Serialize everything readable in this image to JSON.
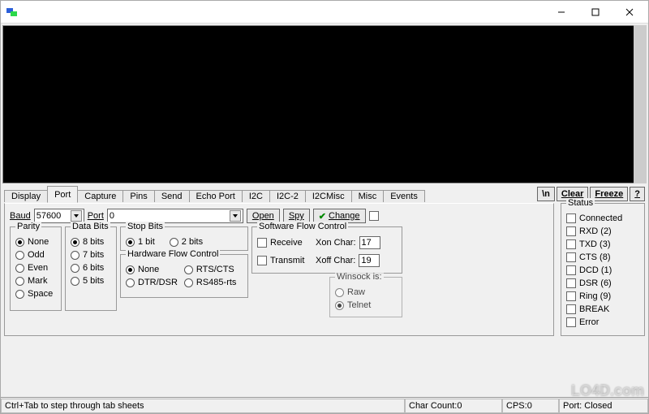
{
  "titlebar": {
    "title": ""
  },
  "window_buttons": {
    "min": "–",
    "max": "☐",
    "close": "✕"
  },
  "tabs": [
    {
      "label": "Display"
    },
    {
      "label": "Port"
    },
    {
      "label": "Capture"
    },
    {
      "label": "Pins"
    },
    {
      "label": "Send"
    },
    {
      "label": "Echo Port"
    },
    {
      "label": "I2C"
    },
    {
      "label": "I2C-2"
    },
    {
      "label": "I2CMisc"
    },
    {
      "label": "Misc"
    },
    {
      "label": "Events"
    }
  ],
  "active_tab": "Port",
  "toolbar": {
    "newline": "\\n",
    "clear": "Clear",
    "freeze": "Freeze",
    "help": "?"
  },
  "port": {
    "baud_label": "Baud",
    "baud_value": "57600",
    "port_label": "Port",
    "port_value": "0",
    "open": "Open",
    "spy": "Spy",
    "change": "Change",
    "change_checked": true
  },
  "parity": {
    "title": "Parity",
    "options": [
      "None",
      "Odd",
      "Even",
      "Mark",
      "Space"
    ],
    "selected": "None"
  },
  "databits": {
    "title": "Data Bits",
    "options": [
      "8 bits",
      "7 bits",
      "6 bits",
      "5 bits"
    ],
    "selected": "8 bits"
  },
  "stopbits": {
    "title": "Stop Bits",
    "options": [
      "1 bit",
      "2 bits"
    ],
    "selected": "1 bit"
  },
  "hwflow": {
    "title": "Hardware Flow Control",
    "options": [
      "None",
      "DTR/DSR",
      "RTS/CTS",
      "RS485-rts"
    ],
    "selected": "None"
  },
  "swflow": {
    "title": "Software Flow Control",
    "receive_label": "Receive",
    "transmit_label": "Transmit",
    "xon_label": "Xon Char:",
    "xon_value": "17",
    "xoff_label": "Xoff Char:",
    "xoff_value": "19"
  },
  "winsock": {
    "title": "Winsock is:",
    "options": [
      "Raw",
      "Telnet"
    ],
    "selected": "Telnet"
  },
  "status": {
    "title": "Status",
    "items": [
      "Connected",
      "RXD (2)",
      "TXD (3)",
      "CTS (8)",
      "DCD (1)",
      "DSR (6)",
      "Ring (9)",
      "BREAK",
      "Error"
    ]
  },
  "statusbar": {
    "hint": "Ctrl+Tab to step through tab sheets",
    "charcount_label": "Char Count:",
    "charcount_value": "0",
    "cps_label": "CPS:",
    "cps_value": "0",
    "port_label": "Port:",
    "port_value": "Closed"
  },
  "watermark": "LO4D.com"
}
